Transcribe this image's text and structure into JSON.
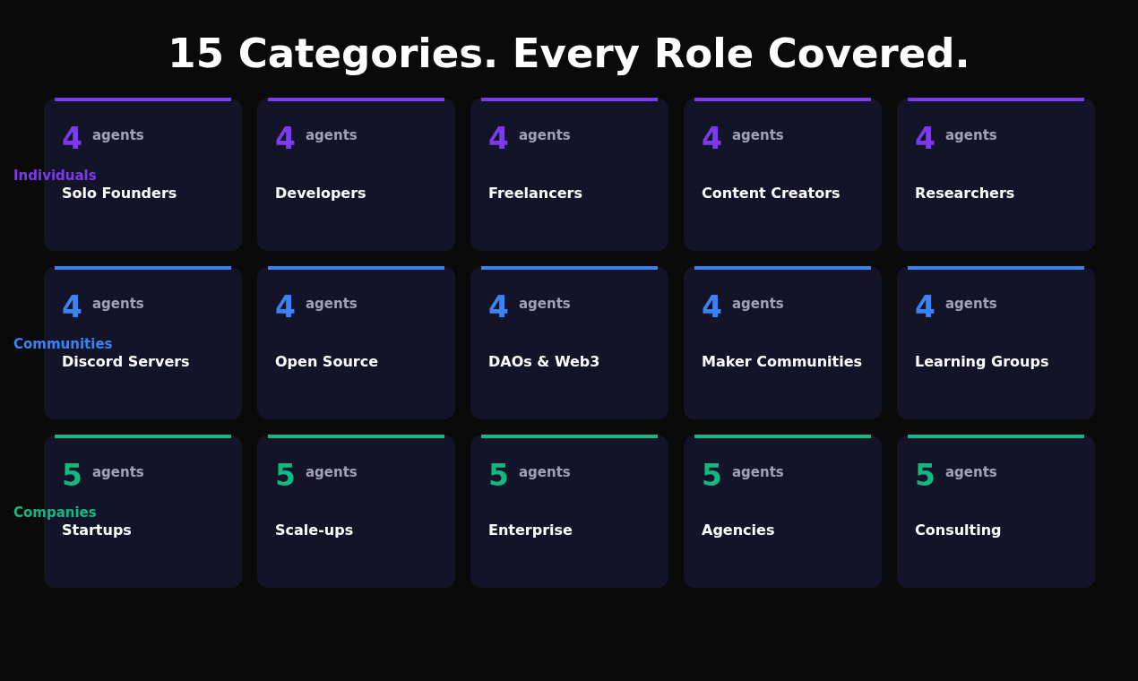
{
  "title": "15 Categories. Every Role Covered.",
  "groups": [
    {
      "label": "Individuals",
      "color": "#7c3aed",
      "cards": [
        {
          "count": "4",
          "unit": "agents",
          "name": "Solo Founders"
        },
        {
          "count": "4",
          "unit": "agents",
          "name": "Developers"
        },
        {
          "count": "4",
          "unit": "agents",
          "name": "Freelancers"
        },
        {
          "count": "4",
          "unit": "agents",
          "name": "Content Creators"
        },
        {
          "count": "4",
          "unit": "agents",
          "name": "Researchers"
        }
      ]
    },
    {
      "label": "Communities",
      "color": "#3b82f6",
      "cards": [
        {
          "count": "4",
          "unit": "agents",
          "name": "Discord Servers"
        },
        {
          "count": "4",
          "unit": "agents",
          "name": "Open Source"
        },
        {
          "count": "4",
          "unit": "agents",
          "name": "DAOs & Web3"
        },
        {
          "count": "4",
          "unit": "agents",
          "name": "Maker Communities"
        },
        {
          "count": "4",
          "unit": "agents",
          "name": "Learning Groups"
        }
      ]
    },
    {
      "label": "Companies",
      "color": "#10b981",
      "cards": [
        {
          "count": "5",
          "unit": "agents",
          "name": "Startups"
        },
        {
          "count": "5",
          "unit": "agents",
          "name": "Scale-ups"
        },
        {
          "count": "5",
          "unit": "agents",
          "name": "Enterprise"
        },
        {
          "count": "5",
          "unit": "agents",
          "name": "Agencies"
        },
        {
          "count": "5",
          "unit": "agents",
          "name": "Consulting"
        }
      ]
    }
  ]
}
